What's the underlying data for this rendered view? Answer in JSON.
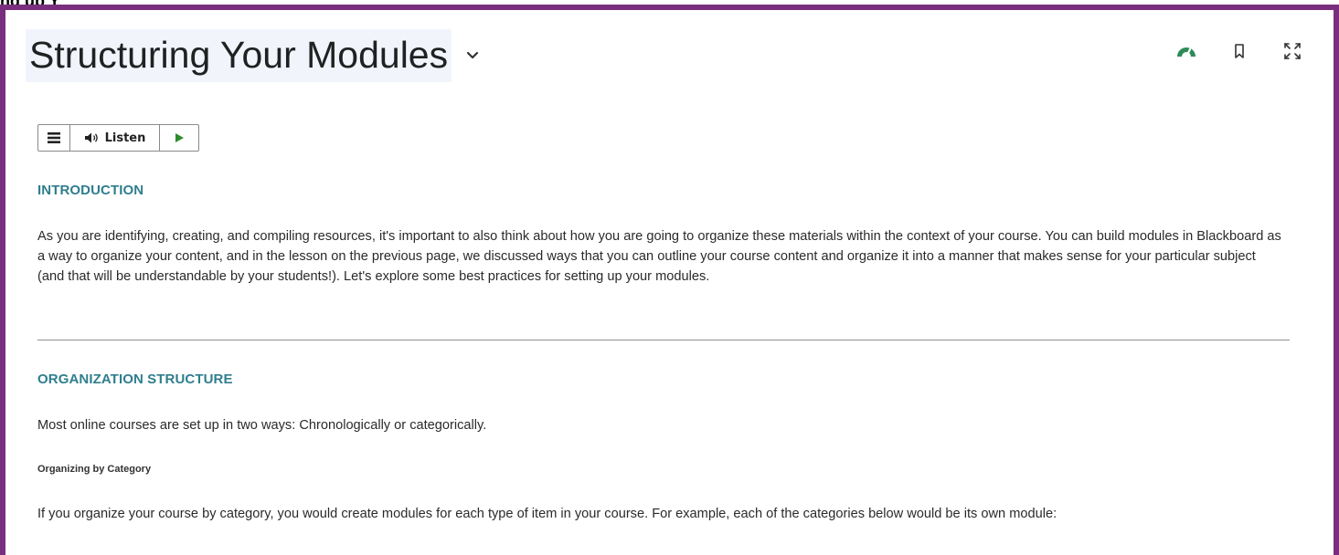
{
  "page": {
    "title": "Structuring Your Modules",
    "accent_color": "#7a2f7e",
    "heading_color": "#2f7e8e"
  },
  "toolbar_icons": [
    {
      "name": "progress-gauge-icon",
      "color": "#2e8b57"
    },
    {
      "name": "bookmark-icon",
      "color": "#333333"
    },
    {
      "name": "fullscreen-icon",
      "color": "#333333"
    }
  ],
  "listen_bar": {
    "listen_label": "Listen"
  },
  "content": {
    "intro_heading": "INTRODUCTION",
    "intro_text": "As you are identifying, creating, and compiling resources, it's important to also think about how you are going to organize these materials within the context of your course. You can build modules in Blackboard as a way to organize your content, and in the lesson on the previous page, we discussed ways that you can outline your course content and organize it into a manner that makes sense for your particular subject (and that will be understandable by your students!).  Let's explore some best practices for setting up your modules.",
    "org_heading": "ORGANIZATION STRUCTURE",
    "org_text": "Most online courses are set up in two ways: Chronologically or categorically.",
    "category_subheading": "Organizing by Category",
    "category_text": "If you organize your course by category, you would create modules for each type of item in your course. For example, each of the categories below would be its own module:"
  }
}
